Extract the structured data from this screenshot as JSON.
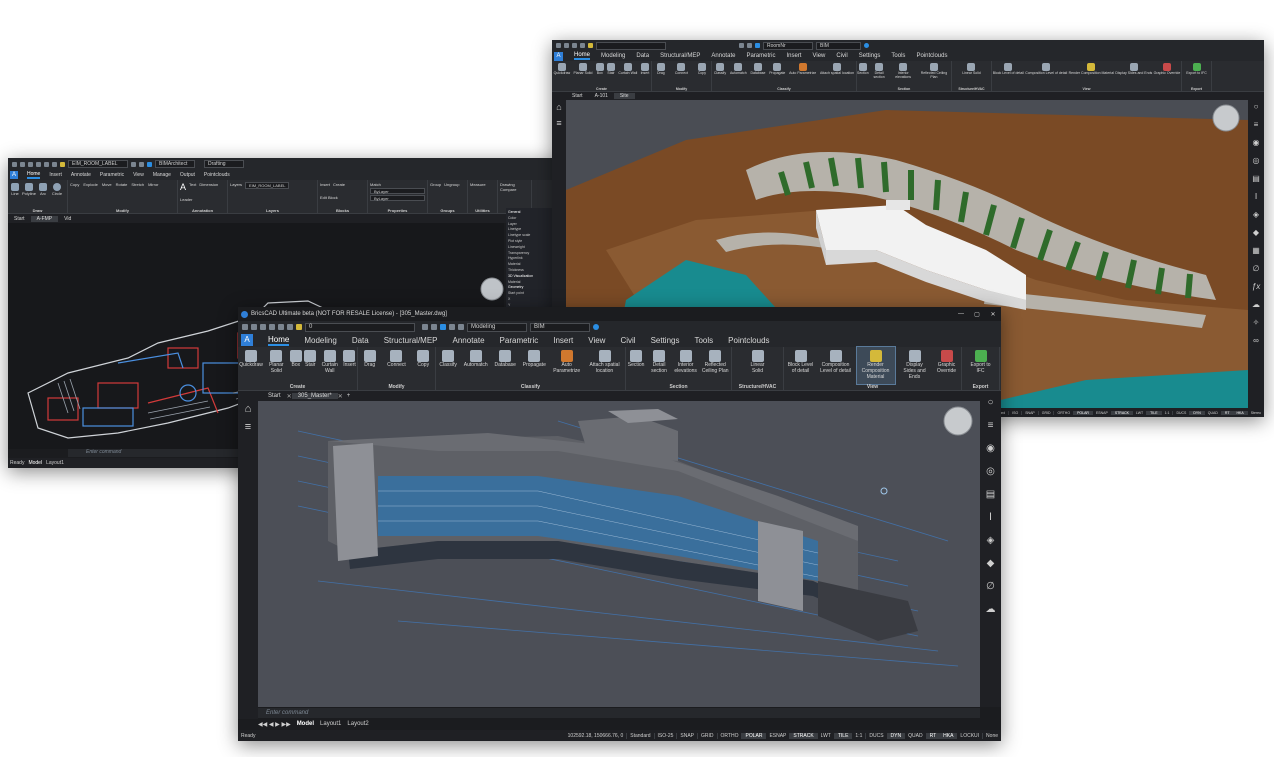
{
  "win_left": {
    "qat_select_1": "EIM_ROOM_LABEL",
    "qat_select_2": "Drafting",
    "qat_select_3": "BIMArchitect",
    "tabs": [
      "Home",
      "Insert",
      "Annotate",
      "Parametric",
      "View",
      "Manage",
      "Output",
      "Pointclouds"
    ],
    "groups": [
      {
        "title": "Draw",
        "tools": [
          "Line",
          "Polyline",
          "Arc",
          "Circle"
        ]
      },
      {
        "title": "Modify",
        "tools": [
          "Copy",
          "Explode",
          "Move",
          "Rotate",
          "Stretch",
          "Mirror"
        ]
      },
      {
        "title": "Annotation",
        "tools": [
          "Text",
          "Dimension",
          "Leader"
        ]
      },
      {
        "title": "Layers",
        "tools": [
          "Layers",
          "EIM_ROOM_LABEL"
        ]
      },
      {
        "title": "Blocks",
        "tools": [
          "Insert",
          "Create",
          "Edit Block"
        ]
      },
      {
        "title": "Properties",
        "tools": [
          "Match",
          "ByLayer",
          "ByLayer"
        ]
      },
      {
        "title": "Groups",
        "tools": [
          "Group",
          "Ungroup"
        ]
      },
      {
        "title": "Utilities",
        "tools": [
          "Measure"
        ]
      },
      {
        "title": "Compare",
        "tools": [
          "Drawing Compare"
        ]
      }
    ],
    "doc_tabs": [
      "Start",
      "A-FMP",
      "Vid"
    ],
    "props_rows": [
      "General",
      "Color",
      "Layer",
      "Linetype",
      "Linetype scale",
      "Plot style",
      "Lineweight",
      "Transparency",
      "Hyperlink",
      "Material",
      "Thickness",
      "3D Visualization",
      "Material",
      "Geometry",
      "Start point",
      "X",
      "Y",
      "Z"
    ],
    "command_placeholder": "Enter command",
    "layout_tabs": [
      "Model",
      "Layout1"
    ],
    "status": "Ready"
  },
  "win_back": {
    "qat_select_1": "RoomNr",
    "qat_select_2": "BIM",
    "tabs": [
      "Home",
      "Modeling",
      "Data",
      "Structural/MEP",
      "Annotate",
      "Parametric",
      "Insert",
      "View",
      "Civil",
      "Settings",
      "Tools",
      "Pointclouds"
    ],
    "groups": [
      {
        "title": "Create",
        "tools": [
          "Quickdraw",
          "Planar Solid",
          "Box",
          "Stair",
          "Curtain Wall",
          "Insert"
        ]
      },
      {
        "title": "Modify",
        "tools": [
          "Drag",
          "Connect",
          "Copy"
        ]
      },
      {
        "title": "Classify",
        "tools": [
          "Classify",
          "Automatch",
          "Database",
          "Propagate",
          "Auto Parametrize",
          "Attach spatial location"
        ]
      },
      {
        "title": "Section",
        "tools": [
          "Section",
          "Detail section",
          "Interior elevations",
          "Reflected Ceiling Plan"
        ]
      },
      {
        "title": "Structure/HVAC",
        "tools": [
          "Linear Solid"
        ]
      },
      {
        "title": "View",
        "tools": [
          "Block Level of detail",
          "Composition Level of detail",
          "Render Composition Material",
          "Display Sides and Ends",
          "Graphic Override"
        ]
      },
      {
        "title": "Export",
        "tools": [
          "Export to IFC"
        ]
      }
    ],
    "doc_tabs": [
      "Start",
      "A-101",
      "Site"
    ],
    "status_items": [
      "Standard",
      "ISO",
      "SNAP",
      "GRID",
      "ORTHO",
      "POLAR",
      "ESNAP",
      "STRACK",
      "LWT",
      "TILE",
      "1:1",
      "DUCS",
      "DYN",
      "QUAD",
      "RT",
      "HKA",
      "Stereo"
    ]
  },
  "win_front": {
    "title": "BricsCAD Ultimate beta (NOT FOR RESALE License) - [305_Master.dwg]",
    "qat_select_1": "0",
    "qat_select_2": "Modeling",
    "qat_select_3": "BIM",
    "app_button": "A",
    "tabs": [
      "Home",
      "Modeling",
      "Data",
      "Structural/MEP",
      "Annotate",
      "Parametric",
      "Insert",
      "View",
      "Civil",
      "Settings",
      "Tools",
      "Pointclouds"
    ],
    "groups": [
      {
        "title": "Create",
        "tools": [
          {
            "label": "Quickdraw",
            "icon": "quickdraw-icon"
          },
          {
            "label": "Planar Solid",
            "icon": "planar-solid-icon"
          },
          {
            "label": "Box",
            "icon": "box-icon"
          },
          {
            "label": "Stair",
            "icon": "stair-icon"
          },
          {
            "label": "Curtain Wall",
            "icon": "curtain-wall-icon"
          },
          {
            "label": "Insert",
            "icon": "insert-icon"
          }
        ]
      },
      {
        "title": "Modify",
        "tools": [
          {
            "label": "Drag",
            "icon": "drag-icon"
          },
          {
            "label": "Connect",
            "icon": "connect-icon"
          },
          {
            "label": "Copy",
            "icon": "copy-icon"
          }
        ]
      },
      {
        "title": "Classify",
        "tools": [
          {
            "label": "Classify",
            "icon": "classify-icon"
          },
          {
            "label": "Automatch",
            "icon": "automatch-icon"
          },
          {
            "label": "Database",
            "icon": "database-icon"
          },
          {
            "label": "Propagate",
            "icon": "propagate-icon"
          },
          {
            "label": "Auto Parametrize",
            "icon": "auto-parametrize-icon"
          },
          {
            "label": "Attach spatial location",
            "icon": "attach-spatial-location-icon"
          }
        ]
      },
      {
        "title": "Section",
        "tools": [
          {
            "label": "Section",
            "icon": "section-icon"
          },
          {
            "label": "Detail section",
            "icon": "detail-section-icon"
          },
          {
            "label": "Interior elevations",
            "icon": "interior-elevations-icon"
          },
          {
            "label": "Reflected Ceiling Plan",
            "icon": "reflected-ceiling-plan-icon"
          }
        ]
      },
      {
        "title": "Structure/HVAC",
        "tools": [
          {
            "label": "Linear Solid",
            "icon": "linear-solid-icon"
          }
        ]
      },
      {
        "title": "View",
        "tools": [
          {
            "label": "Block Level of detail",
            "icon": "block-level-of-detail-icon"
          },
          {
            "label": "Composition Level of detail",
            "icon": "composition-level-of-detail-icon"
          },
          {
            "label": "Render Composition Material",
            "icon": "render-composition-material-icon"
          },
          {
            "label": "Display Sides and Ends",
            "icon": "display-sides-and-ends-icon"
          },
          {
            "label": "Graphic Override",
            "icon": "graphic-override-icon"
          }
        ]
      },
      {
        "title": "Export",
        "tools": [
          {
            "label": "Export to IFC",
            "icon": "export-ifc-icon"
          }
        ]
      }
    ],
    "doc_tabs": [
      "Start",
      "305_Master*"
    ],
    "command_placeholder": "Enter command",
    "layout_tabs": [
      "Model",
      "Layout1",
      "Layout2"
    ],
    "status_ready": "Ready",
    "coords": "102592.18, 150666.76, 0",
    "status_items": [
      {
        "label": "Standard",
        "on": false
      },
      {
        "label": "ISO-25",
        "on": false
      },
      {
        "label": "SNAP",
        "on": false
      },
      {
        "label": "GRID",
        "on": false
      },
      {
        "label": "ORTHO",
        "on": false
      },
      {
        "label": "POLAR",
        "on": true
      },
      {
        "label": "ESNAP",
        "on": false
      },
      {
        "label": "STRACK",
        "on": true
      },
      {
        "label": "LWT",
        "on": false
      },
      {
        "label": "TILE",
        "on": true
      },
      {
        "label": "1:1",
        "on": false
      },
      {
        "label": "DUCS",
        "on": false
      },
      {
        "label": "DYN",
        "on": true
      },
      {
        "label": "QUAD",
        "on": false
      },
      {
        "label": "RT",
        "on": true
      },
      {
        "label": "HKA",
        "on": true
      },
      {
        "label": "LOCKUI",
        "on": false
      },
      {
        "label": "None",
        "on": false
      }
    ]
  },
  "icons": [
    "home-icon",
    "layers-icon",
    "lightbulb-icon",
    "map-pin-icon",
    "cube-icon",
    "search-icon",
    "gear-icon",
    "close-icon",
    "chevron-down-icon"
  ],
  "colors": {
    "accent": "#2b8ee3",
    "app_button": "#2f7fd8",
    "viewport": "#4a4d54",
    "ground": "#7a4a25",
    "grass": "#2f6b2b",
    "water": "#188b8f"
  }
}
